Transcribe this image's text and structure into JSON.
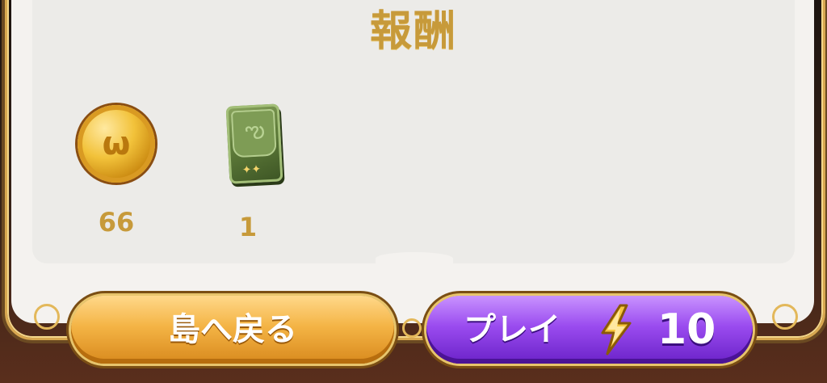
{
  "title": "報酬",
  "rewards": [
    {
      "icon": "coin-icon",
      "count": "66"
    },
    {
      "icon": "card-pack-icon",
      "count": "1"
    }
  ],
  "buttons": {
    "back_label": "島へ戻る",
    "play_label": "プレイ",
    "play_cost": "10",
    "play_cost_icon": "lightning-bolt-icon"
  },
  "colors": {
    "title_gold": "#c79a3a",
    "back_button": "#f4b445",
    "play_button": "#9a4bef"
  }
}
